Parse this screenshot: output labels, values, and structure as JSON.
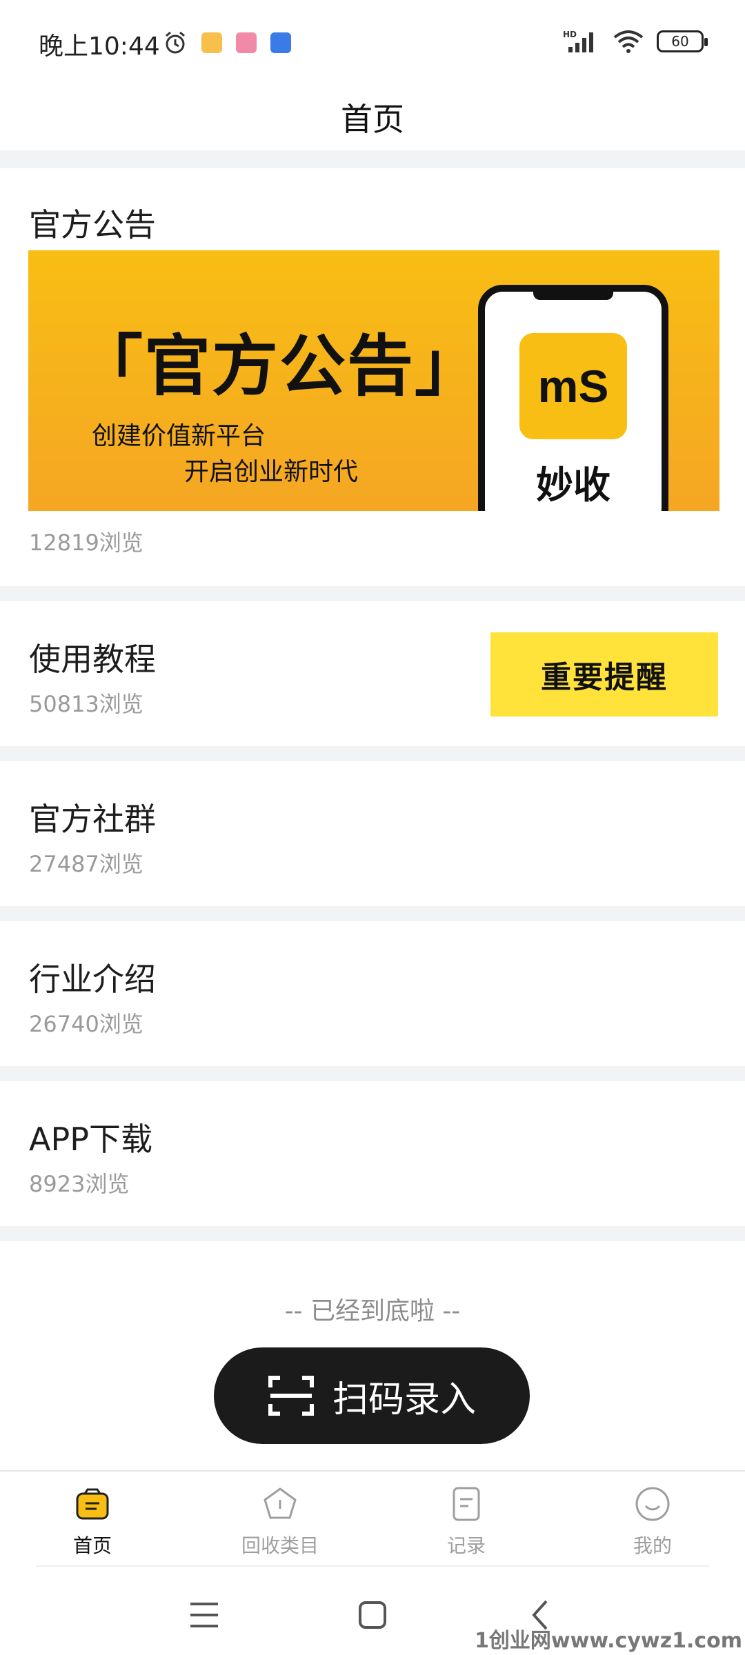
{
  "status_bar": {
    "time": "晚上10:44",
    "network_label": "HD",
    "battery": "60"
  },
  "header": {
    "title": "首页"
  },
  "cards": [
    {
      "title": "官方公告",
      "views": "12819浏览"
    },
    {
      "title": "使用教程",
      "views": "50813浏览"
    },
    {
      "title": "官方社群",
      "views": "27487浏览"
    },
    {
      "title": "行业介绍",
      "views": "26740浏览"
    },
    {
      "title": "APP下载",
      "views": "8923浏览"
    }
  ],
  "banner": {
    "title": "「官方公告」",
    "subtitle_1": "创建价值新平台",
    "subtitle_2": "开启创业新时代",
    "logo": "mS",
    "brand": "妙收"
  },
  "reminder_label": "重要提醒",
  "bottom_note": "-- 已经到底啦 --",
  "scan_button": {
    "label": "扫码录入"
  },
  "tabs": [
    {
      "label": "首页",
      "icon": "home-bag-icon",
      "active": true
    },
    {
      "label": "回收类目",
      "icon": "pentagon-info-icon",
      "active": false
    },
    {
      "label": "记录",
      "icon": "document-icon",
      "active": false
    },
    {
      "label": "我的",
      "icon": "smile-icon",
      "active": false
    }
  ],
  "colors": {
    "accent": "#f8be14",
    "reminder": "#ffe23a",
    "dark": "#1b1b1b",
    "divider": "#f2f3f5"
  },
  "watermark": "1创业网www.cywz1.com"
}
